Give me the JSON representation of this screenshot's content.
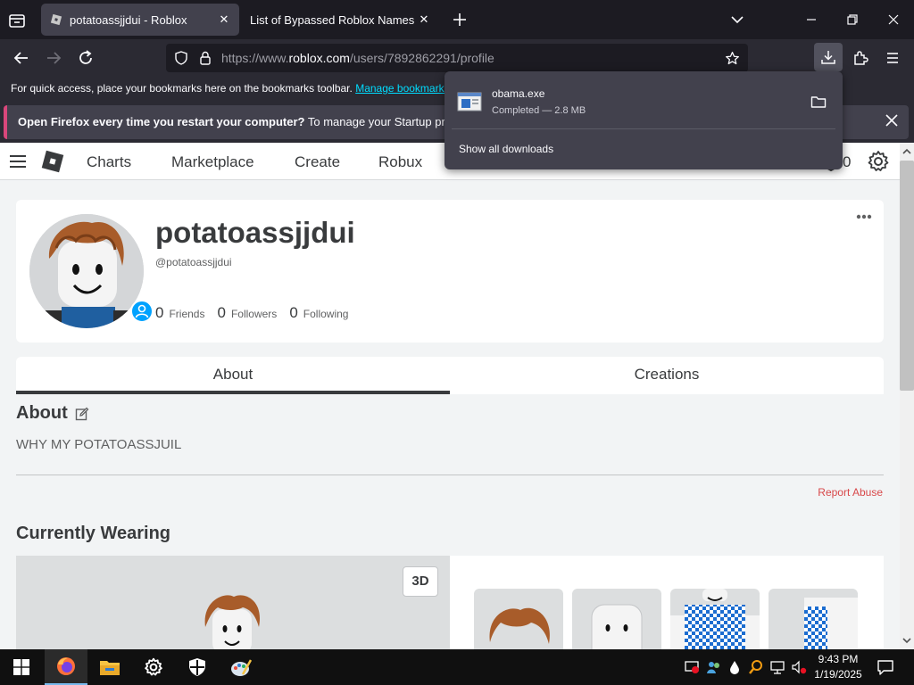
{
  "browser": {
    "tabs": [
      {
        "title": "potatoassjjdui - Roblox",
        "active": true
      },
      {
        "title": "List of Bypassed Roblox Names",
        "active": false
      }
    ],
    "url": {
      "prefix": "https://www.",
      "domain": "roblox.com",
      "path": "/users/7892862291/profile"
    },
    "bookmarks_bar": {
      "text": "For quick access, place your bookmarks here on the bookmarks toolbar.",
      "link": "Manage bookmarks"
    },
    "notice": {
      "bold": "Open Firefox every time you restart your computer?",
      "text": "To manage your Startup preference"
    },
    "downloads": {
      "file_name": "obama.exe",
      "status": "Completed — 2.8 MB",
      "show_all": "Show all downloads"
    }
  },
  "roblox": {
    "nav": [
      "Charts",
      "Marketplace",
      "Create",
      "Robux"
    ],
    "robux_count": "0",
    "profile": {
      "display_name": "potatoassjjdui",
      "username": "@potatoassjjdui",
      "stats": [
        {
          "count": "0",
          "label": "Friends"
        },
        {
          "count": "0",
          "label": "Followers"
        },
        {
          "count": "0",
          "label": "Following"
        }
      ]
    },
    "tabs": [
      "About",
      "Creations"
    ],
    "about": {
      "heading": "About",
      "text": "WHY MY POTATOASSJUIL",
      "report": "Report Abuse"
    },
    "wearing": {
      "heading": "Currently Wearing",
      "btn_3d": "3D"
    }
  },
  "taskbar": {
    "time": "9:43 PM",
    "date": "1/19/2025"
  },
  "colors": {
    "firefox_dark": "#1c1b22",
    "firefox_toolbar": "#2b2a33",
    "accent_cyan": "#00ddff",
    "roblox_blue": "#00a2ff",
    "report_red": "#d8484a"
  }
}
